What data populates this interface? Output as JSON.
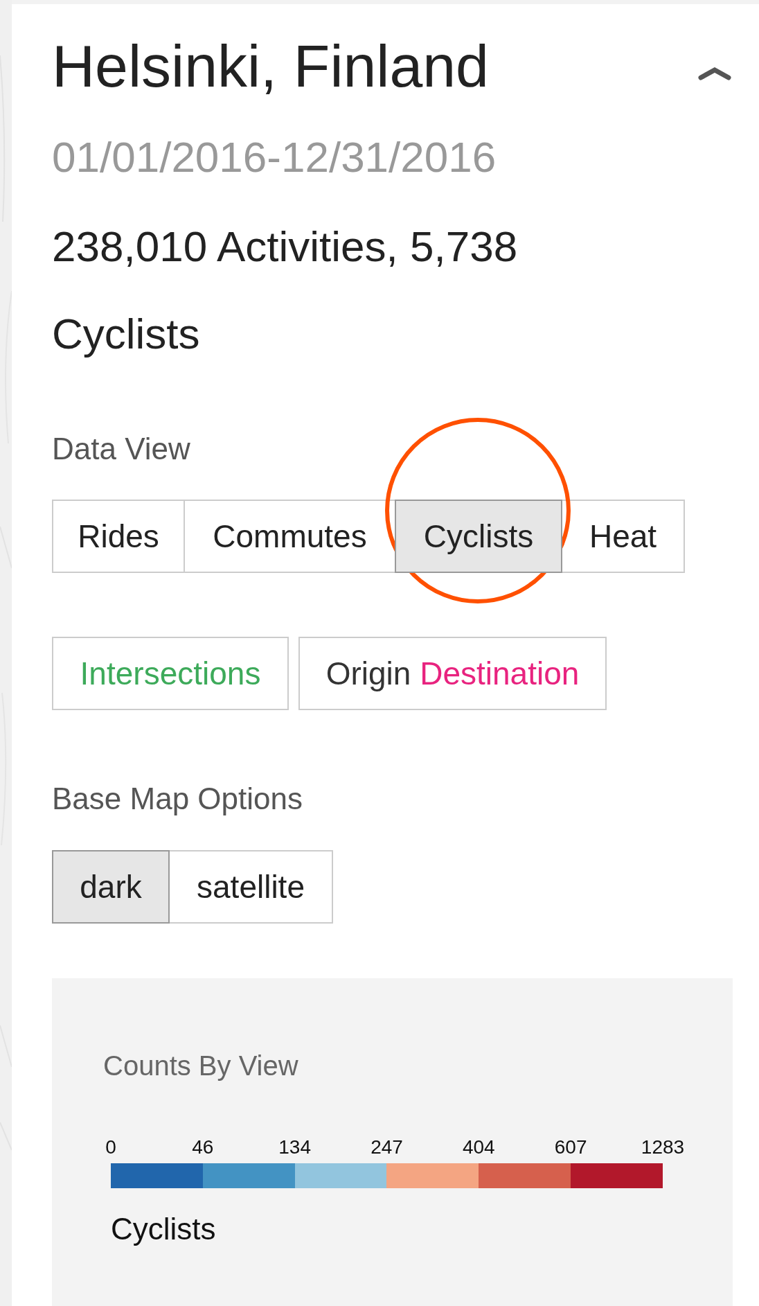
{
  "header": {
    "title": "Helsinki, Finland",
    "date_range": "01/01/2016-12/31/2016",
    "summary": "238,010 Activities, 5,738 Cyclists",
    "expanded": true
  },
  "data_view": {
    "label": "Data View",
    "buttons": [
      {
        "label": "Rides",
        "selected": false
      },
      {
        "label": "Commutes",
        "selected": false
      },
      {
        "label": "Cyclists",
        "selected": true
      },
      {
        "label": "Heat",
        "selected": false
      }
    ],
    "extra_buttons": [
      {
        "parts": [
          {
            "text": "Intersections",
            "color": "#3daa5a"
          }
        ]
      },
      {
        "parts": [
          {
            "text": "Origin",
            "color": "#333333"
          },
          {
            "text": "Destination",
            "color": "#e8237f"
          }
        ]
      }
    ]
  },
  "base_map": {
    "label": "Base Map Options",
    "buttons": [
      {
        "label": "dark",
        "selected": true
      },
      {
        "label": "satellite",
        "selected": false
      }
    ]
  },
  "legend": {
    "title": "Counts By View",
    "ticks": [
      "0",
      "46",
      "134",
      "247",
      "404",
      "607",
      "1283"
    ],
    "segments": [
      {
        "color": "#2166ac"
      },
      {
        "color": "#4393c3"
      },
      {
        "color": "#92c5de"
      },
      {
        "color": "#f4a582"
      },
      {
        "color": "#d6604d"
      },
      {
        "color": "#b2182b"
      }
    ],
    "caption": "Cyclists"
  }
}
